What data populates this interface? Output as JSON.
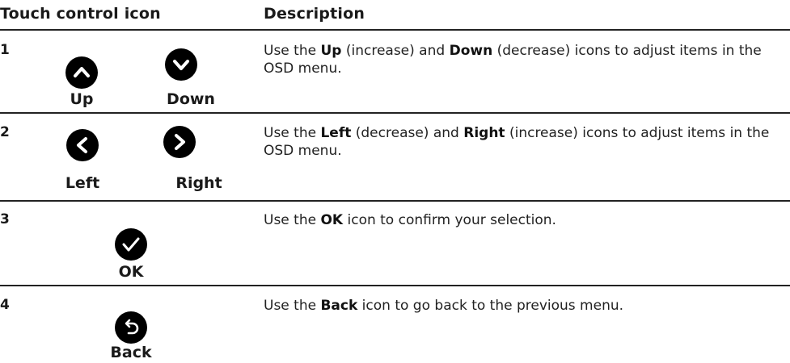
{
  "header": {
    "icon_col": "Touch control icon",
    "desc_col": "Description"
  },
  "rows": [
    {
      "num": "1",
      "labels": [
        "Up",
        "Down"
      ],
      "desc": {
        "a": "Use the ",
        "b1": "Up",
        "c": " (increase) and ",
        "b2": "Down",
        "d": " (decrease) icons to adjust items in the OSD menu."
      }
    },
    {
      "num": "2",
      "labels": [
        "Left",
        "Right"
      ],
      "desc": {
        "a": "Use the ",
        "b1": "Left",
        "c": " (decrease) and ",
        "b2": "Right",
        "d": " (increase) icons to adjust items in the OSD menu."
      }
    },
    {
      "num": "3",
      "labels": [
        "OK"
      ],
      "desc": {
        "a": "Use the ",
        "b1": "OK",
        "c": " icon to confirm your selection."
      }
    },
    {
      "num": "4",
      "labels": [
        "Back"
      ],
      "desc": {
        "a": "Use the ",
        "b1": "Back",
        "c": " icon to go back to the previous menu."
      }
    }
  ],
  "icons": {
    "row1": [
      "chevron-up-icon",
      "chevron-down-icon"
    ],
    "row2": [
      "chevron-left-icon",
      "chevron-right-icon"
    ],
    "row3": [
      "checkmark-icon"
    ],
    "row4": [
      "back-arrow-icon"
    ]
  },
  "colors": {
    "icon_fill": "#000000",
    "icon_glyph": "#ffffff",
    "rule": "#222222"
  }
}
